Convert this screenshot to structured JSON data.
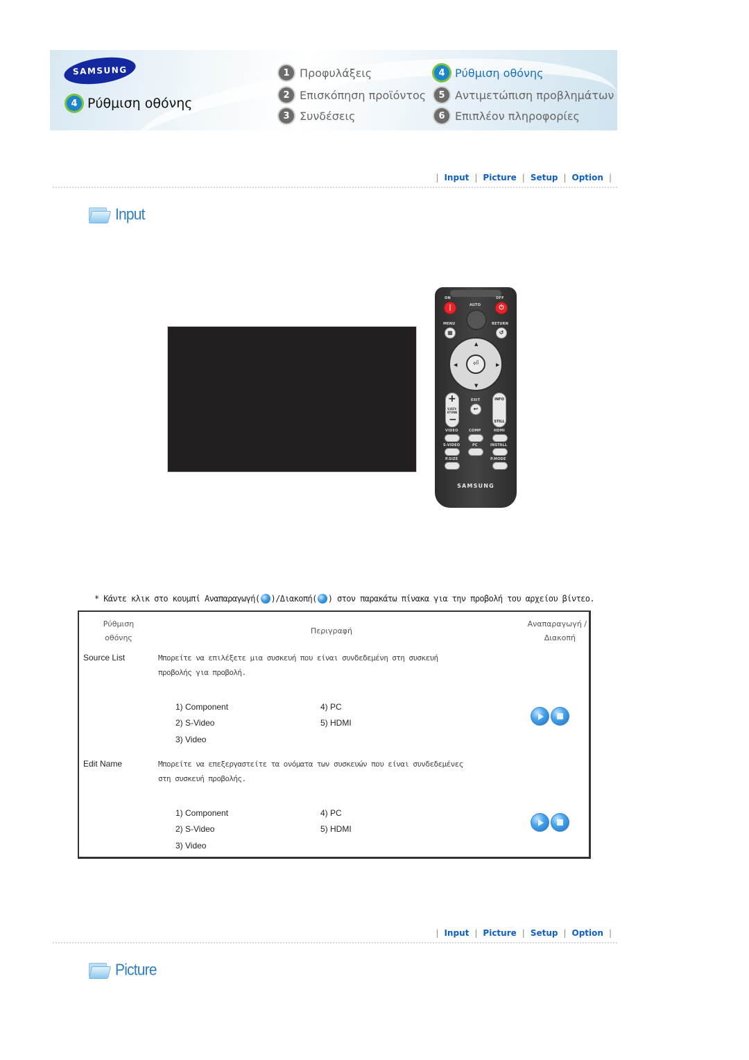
{
  "header": {
    "brand": "SAMSUNG",
    "current_page": {
      "number": "4",
      "title": "Ρύθμιση οθόνης"
    },
    "nav": [
      {
        "number": "1",
        "label": "Προφυλάξεις",
        "current": false
      },
      {
        "number": "2",
        "label": "Επισκόπηση προϊόντος",
        "current": false
      },
      {
        "number": "3",
        "label": "Συνδέσεις",
        "current": false
      },
      {
        "number": "4",
        "label": "Ρύθμιση οθόνης",
        "current": true
      },
      {
        "number": "5",
        "label": "Αντιμετώπιση προβλημάτων",
        "current": false
      },
      {
        "number": "6",
        "label": "Επιπλέον πληροφορίες",
        "current": false
      }
    ]
  },
  "subnav": {
    "items": [
      "Input",
      "Picture",
      "Setup",
      "Option"
    ],
    "separator": "|"
  },
  "sections": {
    "input_title": "Input",
    "picture_title": "Picture"
  },
  "remote": {
    "labels": {
      "on": "ON",
      "off": "OFF",
      "auto": "AUTO",
      "menu": "MENU",
      "return": "RETURN",
      "exit": "EXIT",
      "info": "INFO",
      "still": "STILL",
      "vkeystone": "V.KEY-STONE",
      "video": "VIDEO",
      "comp": "COMP",
      "hdmi": "HDMI",
      "svideo": "S-VIDEO",
      "pc": "PC",
      "install": "INSTALL",
      "psize": "P.SIZE",
      "pmode": "P.MODE"
    },
    "brand": "SAMSUNG"
  },
  "instruction": {
    "prefix": "* Κάντε κλικ στο κουμπί Αναπαραγωγή(",
    "middle": ")/Διακοπή(",
    "suffix": ") στον παρακάτω πίνακα για την προβολή του αρχείου βίντεο."
  },
  "table": {
    "headers": {
      "setting_line1": "Ρύθμιση",
      "setting_line2": "οθόνης",
      "description": "Περιγραφή",
      "control_line1": "Αναπαραγωγή /",
      "control_line2": "Διακοπή"
    },
    "rows": [
      {
        "label": "Source List",
        "desc_line1": "Μπορείτε να επιλέξετε μια συσκευή που είναι συνδεδεμένη στη συσκευή",
        "desc_line2": "προβολής για προβολή.",
        "options": [
          "1) Component",
          "2) S-Video",
          "3) Video",
          "4) PC",
          "5) HDMI"
        ],
        "play_label": "play",
        "stop_label": "stop"
      },
      {
        "label": "Edit Name",
        "desc_line1": "Μπορείτε να επεξεργαστείτε τα ονόματα των συσκευών που είναι συνδεδεμένες",
        "desc_line2": "στη συσκευή προβολής.",
        "options": [
          "1) Component",
          "2) S-Video",
          "3) Video",
          "4) PC",
          "5) HDMI"
        ],
        "play_label": "play",
        "stop_label": "stop"
      }
    ]
  }
}
